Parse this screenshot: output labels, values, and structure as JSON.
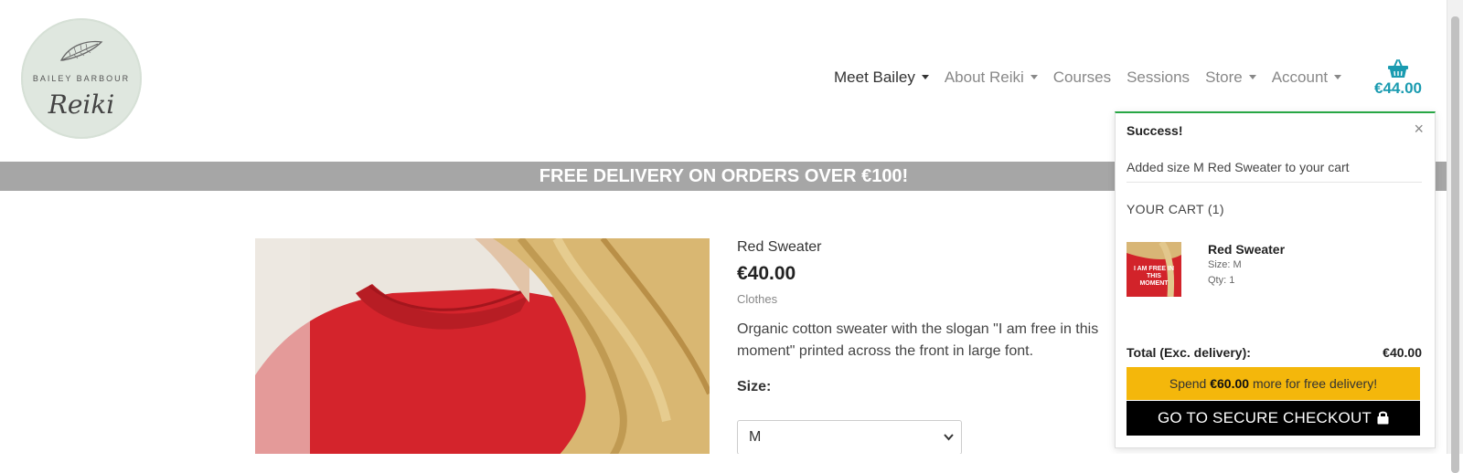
{
  "brand": {
    "top_text": "BAILEY BARBOUR",
    "script_text": "Reiki"
  },
  "nav": {
    "items": [
      {
        "label": "Meet Bailey",
        "dropdown": true,
        "active": true
      },
      {
        "label": "About Reiki",
        "dropdown": true,
        "active": false
      },
      {
        "label": "Courses",
        "dropdown": false,
        "active": false
      },
      {
        "label": "Sessions",
        "dropdown": false,
        "active": false
      },
      {
        "label": "Store",
        "dropdown": true,
        "active": false
      },
      {
        "label": "Account",
        "dropdown": true,
        "active": false
      }
    ],
    "cart_total": "€44.00",
    "cart_icon": "basket-icon"
  },
  "banner": {
    "text": "FREE DELIVERY ON ORDERS OVER €100!"
  },
  "product": {
    "name": "Red Sweater",
    "price": "€40.00",
    "category": "Clothes",
    "description": "Organic cotton sweater with the slogan \"I am free in this moment\" printed across the front in large font.",
    "size_label": "Size:",
    "size_value": "M"
  },
  "toast": {
    "title": "Success!",
    "close": "×",
    "message": "Added size M Red Sweater to your cart",
    "cart_heading": "YOUR CART (1)",
    "item": {
      "name": "Red Sweater",
      "size": "Size: M",
      "qty": "Qty: 1",
      "thumb_text": "I AM FREE IN THIS MOMENT"
    },
    "total_label": "Total (Exc. delivery):",
    "total_value": "€40.00",
    "spend_pre": "Spend ",
    "spend_amount": "€60.00",
    "spend_post": " more for free delivery!",
    "checkout_label": "GO TO SECURE CHECKOUT"
  },
  "colors": {
    "accent": "#1a9bb0",
    "success": "#28a745",
    "spend_bar": "#f4b70b",
    "banner": "#a6a6a6",
    "sweater": "#d2232a"
  }
}
